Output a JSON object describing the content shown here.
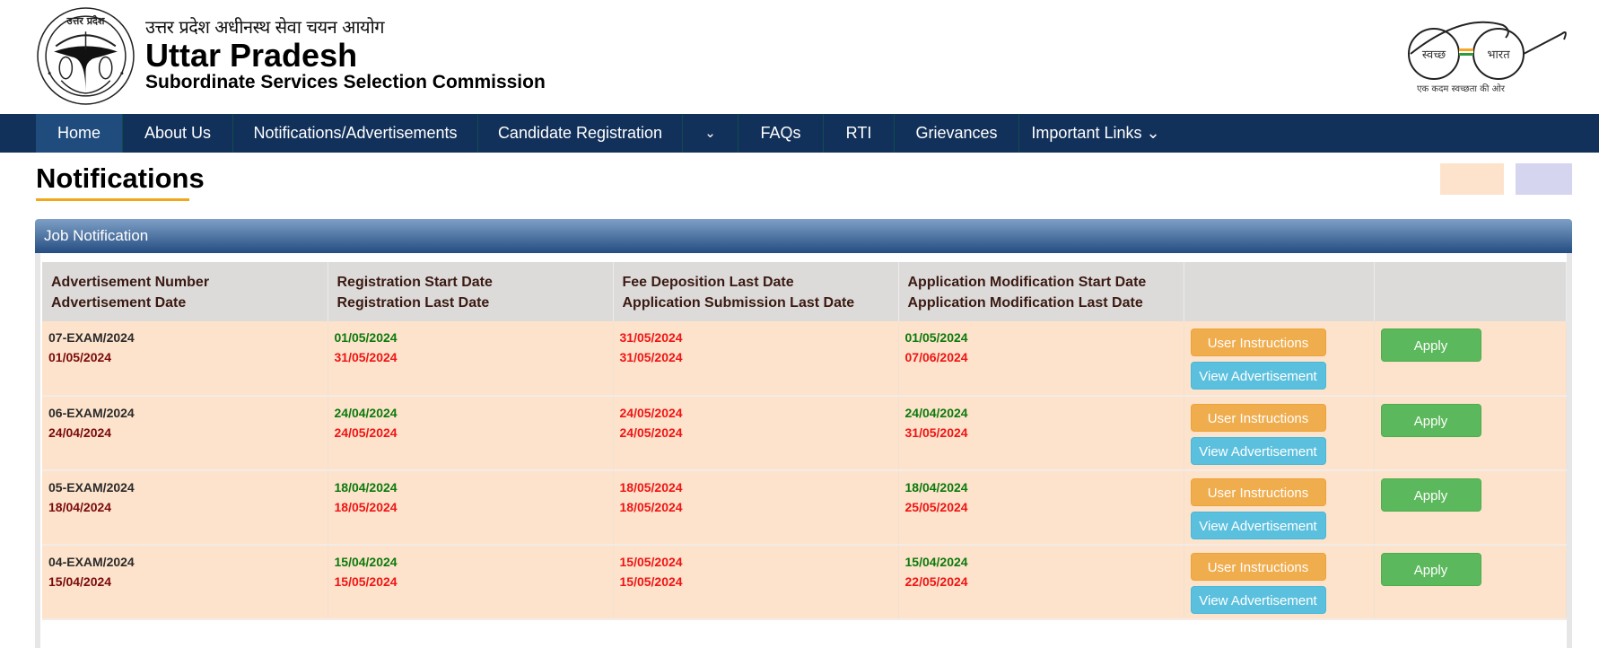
{
  "header": {
    "hindi_title": "उत्तर प्रदेश अधीनस्थ सेवा चयन आयोग",
    "title": "Uttar Pradesh",
    "subtitle": "Subordinate Services Selection Commission",
    "emblem_icon": "up-govt-emblem",
    "swachh_logo": {
      "left_lens": "स्वच्छ",
      "right_lens": "भारत",
      "tagline": "एक कदम स्वच्छता की ओर"
    }
  },
  "nav": {
    "items": [
      {
        "label": "Home",
        "active": true
      },
      {
        "label": "About Us"
      },
      {
        "label": "Notifications/Advertisements"
      },
      {
        "label": "Candidate Registration"
      },
      {
        "label": "⌄"
      },
      {
        "label": "FAQs"
      },
      {
        "label": "RTI"
      },
      {
        "label": "Grievances"
      },
      {
        "label": "Important Links ⌄"
      }
    ]
  },
  "page": {
    "title": "Notifications",
    "legend_colors": [
      "#fde3cc",
      "#d5d5f0"
    ]
  },
  "panel": {
    "title": "Job Notification"
  },
  "table": {
    "headers": [
      [
        "Advertisement Number",
        "Advertisement Date"
      ],
      [
        "Registration Start Date",
        "Registration Last Date"
      ],
      [
        "Fee Deposition Last Date",
        "Application Submission Last Date"
      ],
      [
        "Application Modification Start Date",
        "Application Modification Last Date"
      ],
      [
        "",
        ""
      ],
      [
        "",
        ""
      ]
    ],
    "buttons": {
      "instructions": "User Instructions",
      "view": "View Advertisement",
      "apply": "Apply"
    },
    "rows": [
      {
        "adv_no": "07-EXAM/2024",
        "adv_date": "01/05/2024",
        "reg_start": "01/05/2024",
        "reg_last": "31/05/2024",
        "fee_last": "31/05/2024",
        "submit_last": "31/05/2024",
        "mod_start": "01/05/2024",
        "mod_last": "07/06/2024"
      },
      {
        "adv_no": "06-EXAM/2024",
        "adv_date": "24/04/2024",
        "reg_start": "24/04/2024",
        "reg_last": "24/05/2024",
        "fee_last": "24/05/2024",
        "submit_last": "24/05/2024",
        "mod_start": "24/04/2024",
        "mod_last": "31/05/2024"
      },
      {
        "adv_no": "05-EXAM/2024",
        "adv_date": "18/04/2024",
        "reg_start": "18/04/2024",
        "reg_last": "18/05/2024",
        "fee_last": "18/05/2024",
        "submit_last": "18/05/2024",
        "mod_start": "18/04/2024",
        "mod_last": "25/05/2024"
      },
      {
        "adv_no": "04-EXAM/2024",
        "adv_date": "15/04/2024",
        "reg_start": "15/04/2024",
        "reg_last": "15/05/2024",
        "fee_last": "15/05/2024",
        "submit_last": "15/05/2024",
        "mod_start": "15/04/2024",
        "mod_last": "22/05/2024"
      }
    ]
  }
}
